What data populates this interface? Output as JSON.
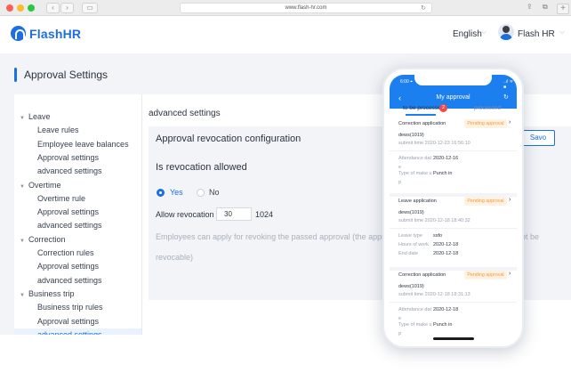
{
  "browser": {
    "url": "www.flash-hr.com",
    "back_glyph": "‹",
    "forward_glyph": "›",
    "sidebar_glyph": "▭",
    "reload_glyph": "↻",
    "share_glyph": "⇪",
    "tabs_glyph": "⧉",
    "new_tab_glyph": "+",
    "traffic_colors": [
      "#fe5f57",
      "#febb2e",
      "#28c840"
    ]
  },
  "header": {
    "brand": "FlashHR",
    "language": "English",
    "user_name": "Flash HR",
    "chevron": "⌵",
    "accent": "#1b6fe0"
  },
  "page": {
    "title": "Approval Settings"
  },
  "sidebar": {
    "items": [
      {
        "label": "Leave",
        "type": "group"
      },
      {
        "label": "Leave rules",
        "type": "sub"
      },
      {
        "label": "Employee leave balances",
        "type": "sub"
      },
      {
        "label": "Approval settings",
        "type": "sub"
      },
      {
        "label": "advanced settings",
        "type": "sub"
      },
      {
        "label": "Overtime",
        "type": "group"
      },
      {
        "label": "Overtime rule",
        "type": "sub"
      },
      {
        "label": "Approval settings",
        "type": "sub"
      },
      {
        "label": "advanced settings",
        "type": "sub"
      },
      {
        "label": "Correction",
        "type": "group"
      },
      {
        "label": "Correction rules",
        "type": "sub"
      },
      {
        "label": "Approval settings",
        "type": "sub"
      },
      {
        "label": "advanced settings",
        "type": "sub"
      },
      {
        "label": "Business trip",
        "type": "group"
      },
      {
        "label": "Business trip rules",
        "type": "sub"
      },
      {
        "label": "Approval settings",
        "type": "sub"
      },
      {
        "label": "advanced settings",
        "type": "sub",
        "active": true
      }
    ]
  },
  "main": {
    "heading": "advanced settings",
    "card_title": "Approval revocation configuration",
    "save_label": "Savo",
    "section_title": "Is revocation allowed",
    "option_yes": "Yes",
    "option_no": "No",
    "selected": "Yes",
    "allow_label": "Allow revocation",
    "allow_value": "30",
    "allow_unit": "1024",
    "hint_line1_left": "Employees can apply for revoking the passed approval (the appr",
    "hint_line1_right": "ot be",
    "hint_line2": "revocable)"
  },
  "phone": {
    "time": "6:00 ⌖",
    "status": "..ıl ᯤ ■",
    "title": "My approval",
    "back": "‹",
    "refresh": "↻",
    "tab_pending": "to be processed",
    "tab_pending_count": "2",
    "tab_processed": "processed",
    "cards": [
      {
        "type": "Correction application",
        "status": "Pending approval",
        "arrow": "›",
        "name": "dews(1019)",
        "submit": "submit time  2020-12-23 16:56:10",
        "fields": [
          {
            "k": "Attendance dat",
            "v": "2020-12-16"
          },
          {
            "k": "e",
            "v": ""
          },
          {
            "k": "Type of make u",
            "v": "Punch in"
          },
          {
            "k": "p",
            "v": ""
          }
        ]
      },
      {
        "type": "Leave application",
        "status": "Pending approval",
        "arrow": "›",
        "name": "dews(1019)",
        "submit": "submit time  2020-12-18 18:40:32",
        "fields": [
          {
            "k": "Leave type",
            "v": "ssfo"
          },
          {
            "k": "Hours of work",
            "v": "2020-12-18"
          },
          {
            "k": "End date",
            "v": "2020-12-18"
          }
        ]
      },
      {
        "type": "Correction application",
        "status": "Pending approval",
        "arrow": "›",
        "name": "dews(1019)",
        "submit": "submit time  2020-12-18 18:31:13",
        "fields": [
          {
            "k": "Attendance dat",
            "v": "2020-12-18"
          },
          {
            "k": "e",
            "v": ""
          },
          {
            "k": "Type of make u",
            "v": "Punch in"
          },
          {
            "k": "p",
            "v": ""
          }
        ]
      }
    ]
  }
}
